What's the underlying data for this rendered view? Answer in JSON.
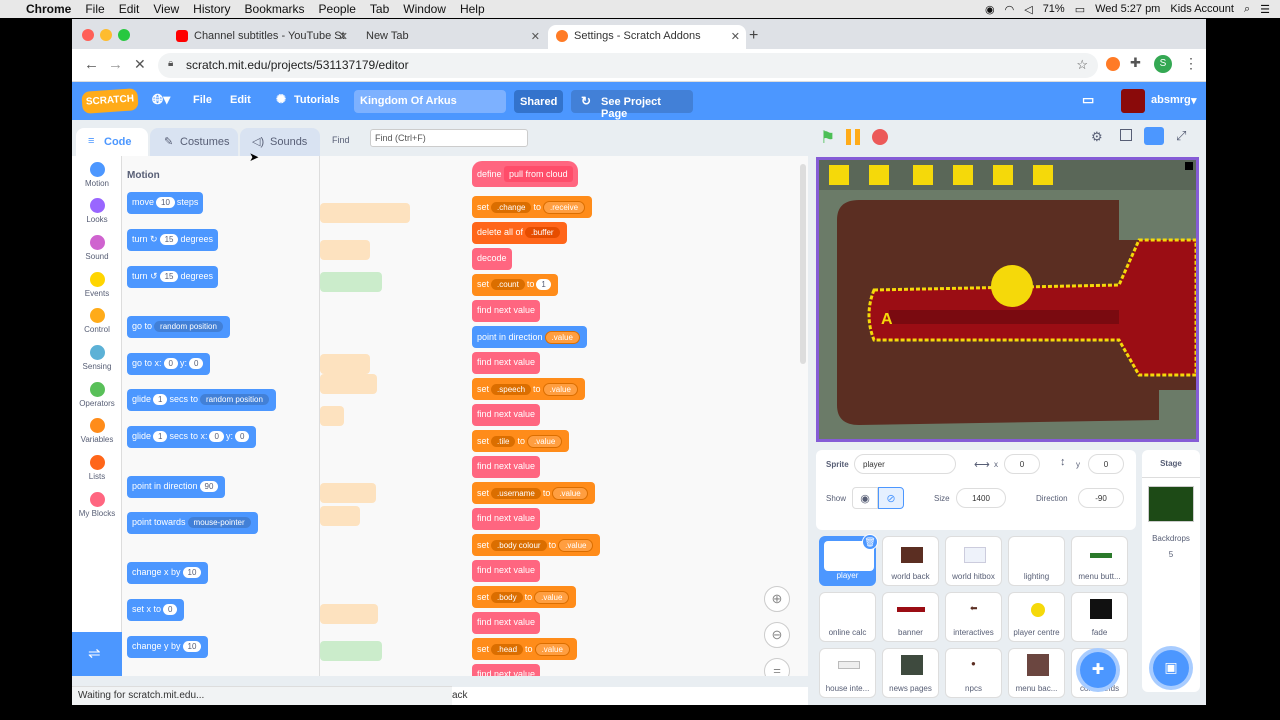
{
  "mac": {
    "apple": "",
    "app": "Chrome",
    "menus": [
      "File",
      "Edit",
      "View",
      "History",
      "Bookmarks",
      "People",
      "Tab",
      "Window",
      "Help"
    ],
    "battery": "71%",
    "clock": "Wed 5:27 pm",
    "user": "Kids Account"
  },
  "browser": {
    "tabs": [
      {
        "title": "Channel subtitles - YouTube St",
        "active": false
      },
      {
        "title": "New Tab",
        "active": false
      },
      {
        "title": "Settings - Scratch Addons",
        "active": true
      }
    ],
    "url": "scratch.mit.edu/projects/531137179/editor",
    "profile": "S",
    "status": "Waiting for scratch.mit.edu..."
  },
  "scratch": {
    "logo": "SCRATCH",
    "menu": {
      "file": "File",
      "edit": "Edit",
      "tutorials": "Tutorials",
      "title": "Kingdom Of Arkus",
      "shared": "Shared",
      "see_project": "See Project Page",
      "username": "absmrg"
    },
    "tabs": {
      "code": "Code",
      "costumes": "Costumes",
      "sounds": "Sounds"
    },
    "find_label": "Find",
    "find_placeholder": "Find (Ctrl+F)",
    "categories": [
      {
        "name": "Motion",
        "color": "#4c97ff"
      },
      {
        "name": "Looks",
        "color": "#9966ff"
      },
      {
        "name": "Sound",
        "color": "#cf63cf"
      },
      {
        "name": "Events",
        "color": "#ffd500"
      },
      {
        "name": "Control",
        "color": "#ffab19"
      },
      {
        "name": "Sensing",
        "color": "#5cb1d6"
      },
      {
        "name": "Operators",
        "color": "#59c059"
      },
      {
        "name": "Variables",
        "color": "#ff8c1a"
      },
      {
        "name": "Lists",
        "color": "#ff661a"
      },
      {
        "name": "My Blocks",
        "color": "#ff6680"
      }
    ],
    "palette": {
      "heading": "Motion",
      "move": {
        "a": "move",
        "n": "10",
        "b": "steps"
      },
      "turn_cw": {
        "a": "turn",
        "n": "15",
        "b": "degrees"
      },
      "turn_ccw": {
        "a": "turn",
        "n": "15",
        "b": "degrees"
      },
      "goto": {
        "a": "go to",
        "d": "random position"
      },
      "gotoxy": {
        "a": "go to x:",
        "x": "0",
        "b": "y:",
        "y": "0"
      },
      "glide": {
        "a": "glide",
        "n": "1",
        "b": "secs to",
        "d": "random position"
      },
      "glidexy": {
        "a": "glide",
        "n": "1",
        "b": "secs to x:",
        "x": "0",
        "c": "y:",
        "y": "0"
      },
      "point": {
        "a": "point in direction",
        "n": "90"
      },
      "towards": {
        "a": "point towards",
        "d": "mouse-pointer"
      },
      "changex": {
        "a": "change x by",
        "n": "10"
      },
      "setx": {
        "a": "set x to",
        "n": "0"
      },
      "changey": {
        "a": "change y by",
        "n": "10"
      }
    },
    "script": {
      "define": "define",
      "define_name": "pull from cloud",
      "set": "set",
      "to": "to",
      "delete_all": "delete all of",
      "decode": "decode",
      "find_next": "find next value",
      "point_dir": "point in direction",
      "v_change": ".change",
      "v_receive": ".receive",
      "v_buffer": ".buffer",
      "v_count": ".count",
      "count_val": "1",
      "v_value": ".value",
      "v_speech": ".speech",
      "v_tile": ".tile",
      "v_username": ".username",
      "v_bodycolour": ".body colour",
      "v_body": ".body",
      "v_head": ".head"
    },
    "sprite": {
      "label": "Sprite",
      "name": "player",
      "x_label": "x",
      "x": "0",
      "y_label": "y",
      "y": "0",
      "show_label": "Show",
      "size_label": "Size",
      "size": "1400",
      "dir_label": "Direction",
      "direction": "-90"
    },
    "sprites": [
      "player",
      "world back",
      "world hitbox",
      "lighting",
      "menu butt...",
      "online calc",
      "banner",
      "interactives",
      "player centre",
      "fade",
      "house inte...",
      "news pages",
      "npcs",
      "menu bac...",
      "commands"
    ],
    "stage": {
      "label": "Stage",
      "backdrops_label": "Backdrops",
      "backdrops": "5"
    },
    "back_text": "ack"
  }
}
